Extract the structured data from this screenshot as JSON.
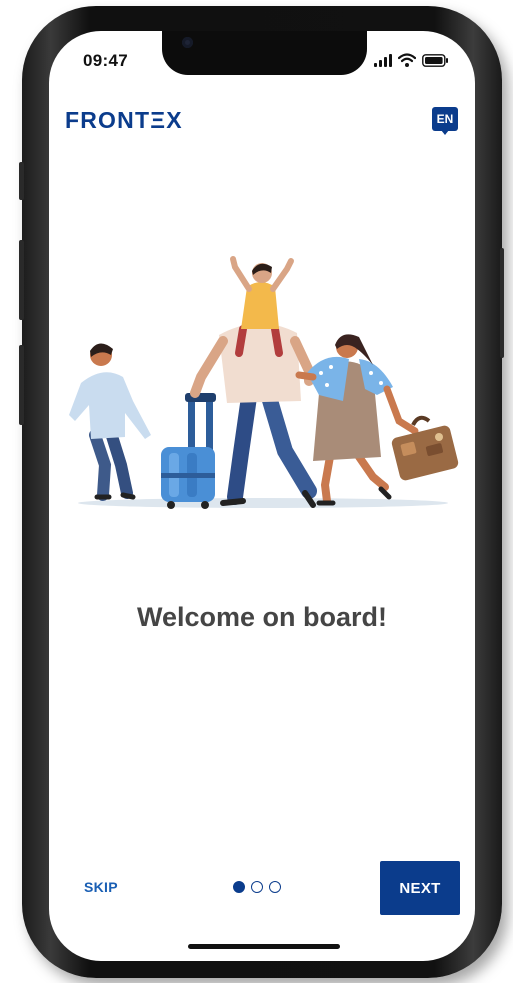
{
  "status_bar": {
    "time": "09:47"
  },
  "header": {
    "logo_text": "FRONTΞX",
    "language_badge": "EN"
  },
  "onboarding": {
    "title": "Welcome on board!",
    "page_indicator": {
      "total": 3,
      "current": 1
    }
  },
  "footer": {
    "skip_label": "SKIP",
    "next_label": "NEXT"
  },
  "colors": {
    "brand_blue": "#0b3c8c",
    "skip_blue": "#1a5fb4",
    "title_gray": "#454545"
  },
  "icons": [
    "signal-icon",
    "wifi-icon",
    "battery-icon",
    "language-icon"
  ]
}
